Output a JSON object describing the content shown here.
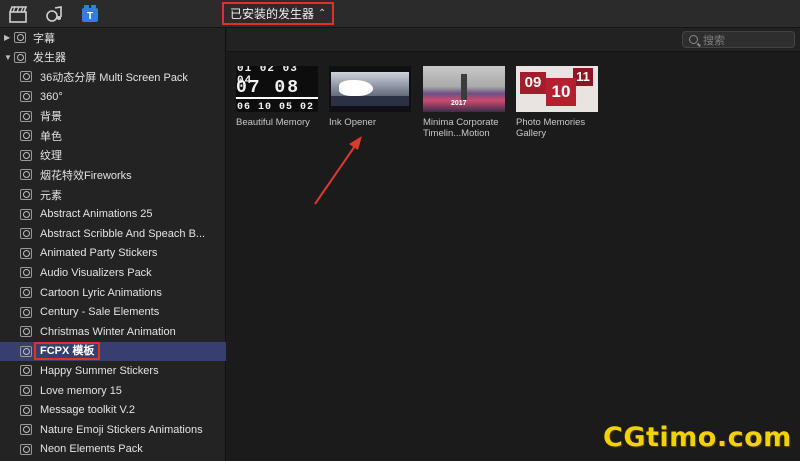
{
  "toolbar": {
    "icons": [
      "clapper-icon",
      "music-photo-icon",
      "titles-generators-icon"
    ],
    "dropdown_label": "已安装的发生器",
    "dropdown_chevron": "⌃⌄"
  },
  "sidebar": {
    "top_items": [
      {
        "label": "字幕",
        "expanded": false
      },
      {
        "label": "发生器",
        "expanded": true
      }
    ],
    "items": [
      {
        "label": "36动态分屏 Multi Screen Pack"
      },
      {
        "label": "360°"
      },
      {
        "label": "背景"
      },
      {
        "label": "单色"
      },
      {
        "label": "纹理"
      },
      {
        "label": "烟花特效Fireworks"
      },
      {
        "label": "元素"
      },
      {
        "label": "Abstract Animations 25"
      },
      {
        "label": "Abstract Scribble And Speach B..."
      },
      {
        "label": "Animated Party Stickers"
      },
      {
        "label": "Audio Visualizers Pack"
      },
      {
        "label": "Cartoon Lyric Animations"
      },
      {
        "label": "Century - Sale Elements"
      },
      {
        "label": "Christmas Winter Animation"
      },
      {
        "label": "FCPX 模板",
        "selected": true
      },
      {
        "label": "Happy Summer Stickers"
      },
      {
        "label": "Love memory 15"
      },
      {
        "label": "Message toolkit V.2"
      },
      {
        "label": "Nature Emoji Stickers Animations"
      },
      {
        "label": "Neon Elements Pack"
      }
    ]
  },
  "browser": {
    "search_placeholder": "搜索",
    "tiles": [
      {
        "caption": "Beautiful Memory",
        "thumb": {
          "row1": "01 02 03 04",
          "row2": "07  08",
          "row3": "06 10 05 02"
        }
      },
      {
        "caption": "Ink Opener"
      },
      {
        "caption": "Minima Corporate Timelin...Motion",
        "thumb": {
          "year": "2017"
        }
      },
      {
        "caption": "Photo Memories Gallery",
        "thumb": {
          "a": "09",
          "b": "10",
          "c": "11"
        }
      }
    ]
  },
  "watermark": "CGtimo.com",
  "colors": {
    "highlight_box": "#e0302c",
    "selection": "#363f6f",
    "watermark": "#f2d200"
  }
}
